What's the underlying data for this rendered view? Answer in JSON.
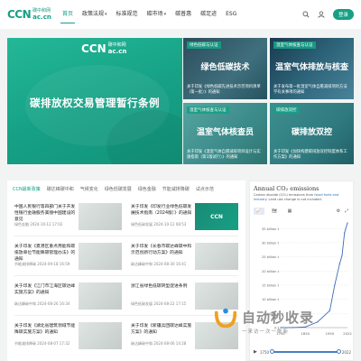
{
  "header": {
    "logo_mark": "CCN",
    "logo_cn": "碳中和网",
    "logo_domain": "ac.cn",
    "nav": [
      {
        "label": "首页",
        "active": true,
        "caret": false
      },
      {
        "label": "政策法规",
        "active": false,
        "caret": true
      },
      {
        "label": "标准规范",
        "active": false,
        "caret": false
      },
      {
        "label": "碳市场",
        "active": false,
        "caret": true
      },
      {
        "label": "碳普惠",
        "active": false,
        "caret": false
      },
      {
        "label": "碳足迹",
        "active": false,
        "caret": false
      },
      {
        "label": "ESG",
        "active": false,
        "caret": false
      }
    ],
    "login_label": "登录"
  },
  "hero": {
    "main_title": "碳排放权交易管理暂行条例",
    "cards": [
      {
        "tag": "绿色低碳与认证",
        "title": "绿色低碳技术",
        "desc": "关于印发《绿色低碳先进技术示范项目清单（第一批）》的通知"
      },
      {
        "tag": "温室气体核查与认证",
        "title": "温室气体排放与核查",
        "desc": "关于发布第一批温室气体自愿减排项目方法学有关事项的通知"
      },
      {
        "tag": "温室气体核查与认证",
        "title": "温室气体核查员",
        "desc": "关于印发《温室气体自愿减排项目设计与实施指南（第1版试行）》的通知"
      },
      {
        "tag": "碳排放双控",
        "title": "碳排放双控",
        "desc": "关于印发《加快构建碳排放双控制度体系工作方案》的通知"
      }
    ]
  },
  "news": {
    "tabs": [
      {
        "label": "CCN最新政策",
        "active": true
      },
      {
        "label": "碳达峰碳中和",
        "active": false
      },
      {
        "label": "气候变化",
        "active": false
      },
      {
        "label": "绿色低碳发展",
        "active": false
      },
      {
        "label": "绿色金融",
        "active": false
      },
      {
        "label": "节能减排降碳",
        "active": false
      },
      {
        "label": "试点示范",
        "active": false
      }
    ],
    "items": [
      {
        "title": "中国人民银行等四部门关于开发性银行金融服务美丽中国建设的意见",
        "source": "绿色金融   2024-10-12 17:02"
      },
      {
        "title": "关于印发《印发行业绿色低碳发展技术指南（2024版）》的通知",
        "source": "绿色低碳发展   2024-10-12 08:53"
      },
      {
        "title": "关于印发《夏港区重点用能和碳排放单位节能降碳管理办法》的通知",
        "source": "节能减排降碳   2024-09-18 16:59"
      },
      {
        "title": "关于印发《长春市碳达峰碳中和示范创新行动方案》的通知",
        "source": "碳达峰碳中和   2024-08-30 16:41"
      },
      {
        "title": "关于印发《江门市江海区碳达峰实施方案》的通知",
        "source": "碳达峰碳中和   2024-08-26 16:34"
      },
      {
        "title": "浙江省绿色低碳转型促进条例",
        "source": "绿色低碳发展   2024-08-22 17:15"
      },
      {
        "title": "关于印发《湖北省建筑领域节能降碳实施方案》的通知",
        "source": "节能减排降碳   2024-08-07 17:32"
      },
      {
        "title": "关于印发《新疆兵团碳达峰实施方案》的通知",
        "source": "碳达峰碳中和   2024-08-06 14:28"
      }
    ]
  },
  "chart_panel": {
    "title": "Annual CO₂ emissions",
    "subtitle_a": "Carbon dioxide (CO₂) emissions from ",
    "subtitle_link": "fossil fuels and industry",
    "subtitle_b": ". Land use change is not included.",
    "tools": [
      "Chart",
      "Map",
      "Table"
    ],
    "tool_selected": "Chart",
    "right_tools": [
      "settings-icon",
      "expand-icon",
      "download-icon",
      "share-icon"
    ],
    "play_label": "▶",
    "year_start": "1750",
    "year_end": "2022"
  },
  "chart_data": {
    "type": "line",
    "title": "Annual CO₂ emissions",
    "x": [
      1750,
      1800,
      1850,
      1900,
      1950,
      1970,
      1990,
      2000,
      2010,
      2022
    ],
    "series": [
      {
        "values": [
          0.01,
          0.03,
          0.2,
          2.0,
          6.0,
          15.0,
          22.5,
          25.5,
          33.5,
          37.0
        ]
      }
    ],
    "y_ticks": [
      "0 t",
      "5 billion t",
      "10 billion t",
      "15 billion t",
      "20 billion t",
      "25 billion t",
      "30 billion t",
      "35 billion t"
    ],
    "x_ticks": [
      "1750",
      "1850",
      "1950",
      "2022"
    ],
    "ylim": [
      0,
      37
    ],
    "xlim": [
      1750,
      2022
    ],
    "grid": true,
    "line_color": "#3b6bb5"
  },
  "watermark": {
    "text": "自动秒收录",
    "sub": "一来访一次一刷新"
  }
}
